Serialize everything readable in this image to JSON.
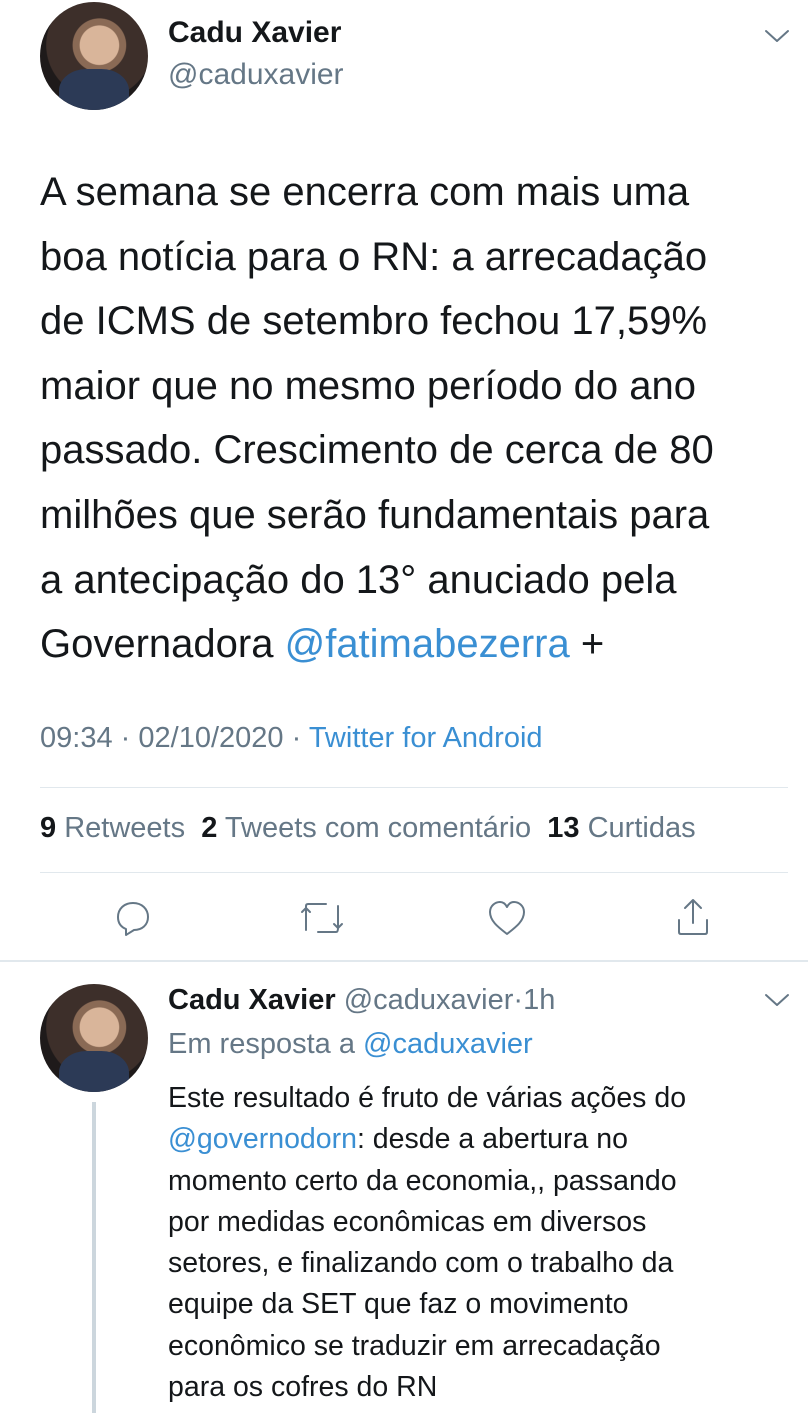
{
  "main_tweet": {
    "author_name": "Cadu Xavier",
    "author_handle": "@caduxavier",
    "text_lines": [
      "A semana se encerra com mais uma",
      "boa notícia para o RN: a arrecadação",
      "de ICMS de setembro fechou 17,59%",
      "maior que no mesmo período do ano",
      "passado. Crescimento de cerca de 80",
      "milhões que serão fundamentais para",
      "a antecipação do 13° anuciado pela"
    ],
    "last_line_prefix": "Governadora ",
    "last_line_mention": "@fatimabezerra",
    "last_line_suffix": " +",
    "time": "09:34",
    "date": "02/10/2020",
    "sep": "·",
    "source": "Twitter for Android",
    "stats": {
      "retweets_count": "9",
      "retweets_label": "Retweets",
      "quotes_count": "2",
      "quotes_label": "Tweets com comentário",
      "likes_count": "13",
      "likes_label": "Curtidas"
    }
  },
  "reply": {
    "author_name": "Cadu Xavier",
    "author_handle": "@caduxavier",
    "sep": "·",
    "age": "1h",
    "in_reply_prefix": "Em resposta a ",
    "in_reply_handle": "@caduxavier",
    "line1": "Este resultado é fruto de várias ações do",
    "line2_mention": "@governodorn",
    "line2_rest": ": desde a abertura no",
    "lines_rest": [
      "momento certo da economia,, passando",
      "por medidas econômicas em diversos",
      "setores, e finalizando com o trabalho da",
      "equipe da SET que faz o movimento",
      "econômico se traduzir em arrecadação",
      "para os cofres do RN"
    ]
  },
  "icons": {
    "reply": "reply-icon",
    "retweet": "retweet-icon",
    "like": "heart-icon",
    "share": "share-icon",
    "menu": "chevron-down-icon"
  },
  "colors": {
    "link": "#3a8fd3",
    "muted": "#657786",
    "divider": "#e1e8ed"
  }
}
